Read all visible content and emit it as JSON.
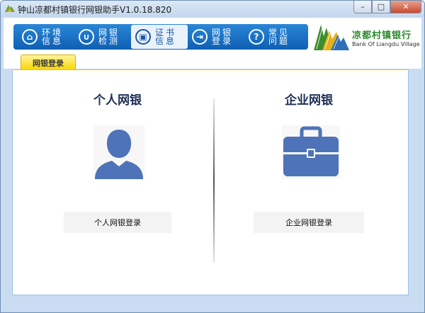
{
  "window": {
    "title": "钟山凉都村镇银行网银助手V1.0.18.820",
    "controls": {
      "minimize": "–",
      "maximize": "□",
      "close": "✕"
    }
  },
  "nav": [
    {
      "name": "env",
      "line1": "环境",
      "line2": "信息",
      "icon": "home-icon",
      "glyph": "⌂",
      "active": false
    },
    {
      "name": "check",
      "line1": "网银",
      "line2": "检测",
      "icon": "stethoscope-icon",
      "glyph": "∪",
      "active": false
    },
    {
      "name": "cert",
      "line1": "证书",
      "line2": "信息",
      "icon": "certificate-icon",
      "glyph": "▣",
      "active": true
    },
    {
      "name": "login",
      "line1": "网银",
      "line2": "登录",
      "icon": "login-icon",
      "glyph": "⇥",
      "active": false
    },
    {
      "name": "faq",
      "line1": "常见",
      "line2": "问题",
      "icon": "question-icon",
      "glyph": "?",
      "active": false
    }
  ],
  "logo": {
    "cn": "凉都村镇银行",
    "en": "Bank Of Liangdu Village"
  },
  "tab": {
    "label": "网银登录"
  },
  "personal": {
    "title": "个人网银",
    "login_label": "个人网银登录"
  },
  "corporate": {
    "title": "企业网银",
    "login_label": "企业网银登录"
  },
  "colors": {
    "accent_blue": "#1565c0",
    "icon_blue": "#4e79bd",
    "tab_yellow": "#f9d600",
    "logo_green": "#2c8a2e"
  }
}
